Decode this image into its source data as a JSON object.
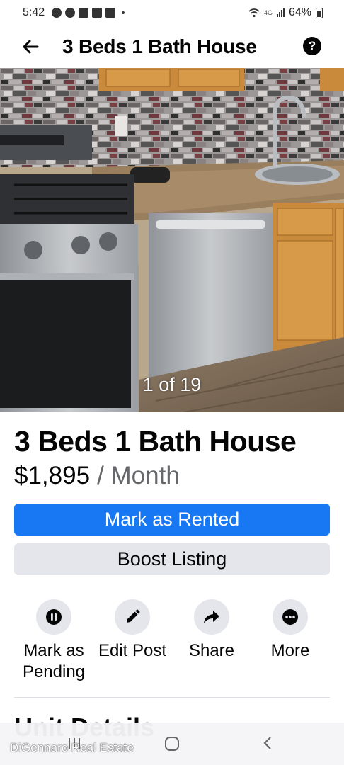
{
  "status_bar": {
    "time": "5:42",
    "network": "4G",
    "battery": "64%"
  },
  "header": {
    "title": "3 Beds 1 Bath House",
    "back_icon": "arrow-left-icon",
    "help_icon": "question-circle-icon",
    "help_glyph": "?"
  },
  "photo": {
    "counter": "1 of 19",
    "current_index": 1,
    "total": 19
  },
  "listing": {
    "title": "3 Beds 1 Bath House",
    "price": "$1,895",
    "period": "/ Month"
  },
  "buttons": {
    "primary_label": "Mark as Rented",
    "secondary_label": "Boost Listing"
  },
  "actions": [
    {
      "icon": "pause-icon",
      "line1": "Mark as",
      "line2": "Pending"
    },
    {
      "icon": "pencil-icon",
      "line1": "Edit Post",
      "line2": ""
    },
    {
      "icon": "share-arrow-icon",
      "line1": "Share",
      "line2": ""
    },
    {
      "icon": "more-dots-icon",
      "line1": "More",
      "line2": ""
    }
  ],
  "section": {
    "heading": "Unit Details"
  },
  "watermark": "DiGennaro Real Estate",
  "colors": {
    "accent": "#1877f2",
    "secondary_button": "#e4e6eb",
    "muted_text": "#65676b",
    "text": "#050505"
  }
}
